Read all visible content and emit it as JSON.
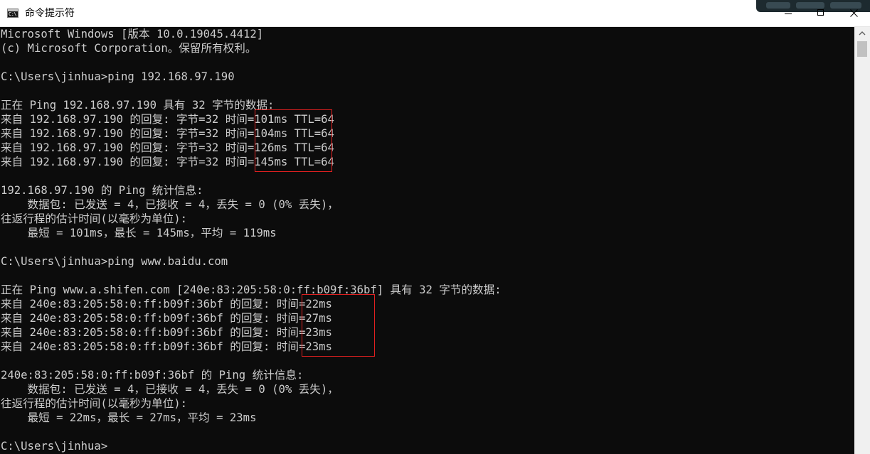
{
  "window": {
    "title": "命令提示符",
    "icon": "console-app-icon",
    "icon_glyph": "C:\\"
  },
  "console": {
    "foreground": "#cccccc",
    "background": "#0c0c0c",
    "highlight_color": "#e02020",
    "lines": [
      "Microsoft Windows [版本 10.0.19045.4412]",
      "(c) Microsoft Corporation。保留所有权利。",
      "",
      "C:\\Users\\jinhua>ping 192.168.97.190",
      "",
      "正在 Ping 192.168.97.190 具有 32 字节的数据:",
      "来自 192.168.97.190 的回复: 字节=32 时间=101ms TTL=64",
      "来自 192.168.97.190 的回复: 字节=32 时间=104ms TTL=64",
      "来自 192.168.97.190 的回复: 字节=32 时间=126ms TTL=64",
      "来自 192.168.97.190 的回复: 字节=32 时间=145ms TTL=64",
      "",
      "192.168.97.190 的 Ping 统计信息:",
      "    数据包: 已发送 = 4，已接收 = 4，丢失 = 0 (0% 丢失)，",
      "往返行程的估计时间(以毫秒为单位):",
      "    最短 = 101ms，最长 = 145ms，平均 = 119ms",
      "",
      "C:\\Users\\jinhua>ping www.baidu.com",
      "",
      "正在 Ping www.a.shifen.com [240e:83:205:58:0:ff:b09f:36bf] 具有 32 字节的数据:",
      "来自 240e:83:205:58:0:ff:b09f:36bf 的回复: 时间=22ms",
      "来自 240e:83:205:58:0:ff:b09f:36bf 的回复: 时间=27ms",
      "来自 240e:83:205:58:0:ff:b09f:36bf 的回复: 时间=23ms",
      "来自 240e:83:205:58:0:ff:b09f:36bf 的回复: 时间=23ms",
      "",
      "240e:83:205:58:0:ff:b09f:36bf 的 Ping 统计信息:",
      "    数据包: 已发送 = 4，已接收 = 4，丢失 = 0 (0% 丢失)，",
      "往返行程的估计时间(以毫秒为单位):",
      "    最短 = 22ms，最长 = 27ms，平均 = 23ms",
      "",
      "C:\\Users\\jinhua>"
    ]
  },
  "controls": {
    "minimize": "minimize-icon",
    "maximize": "maximize-icon",
    "close": "close-icon"
  }
}
